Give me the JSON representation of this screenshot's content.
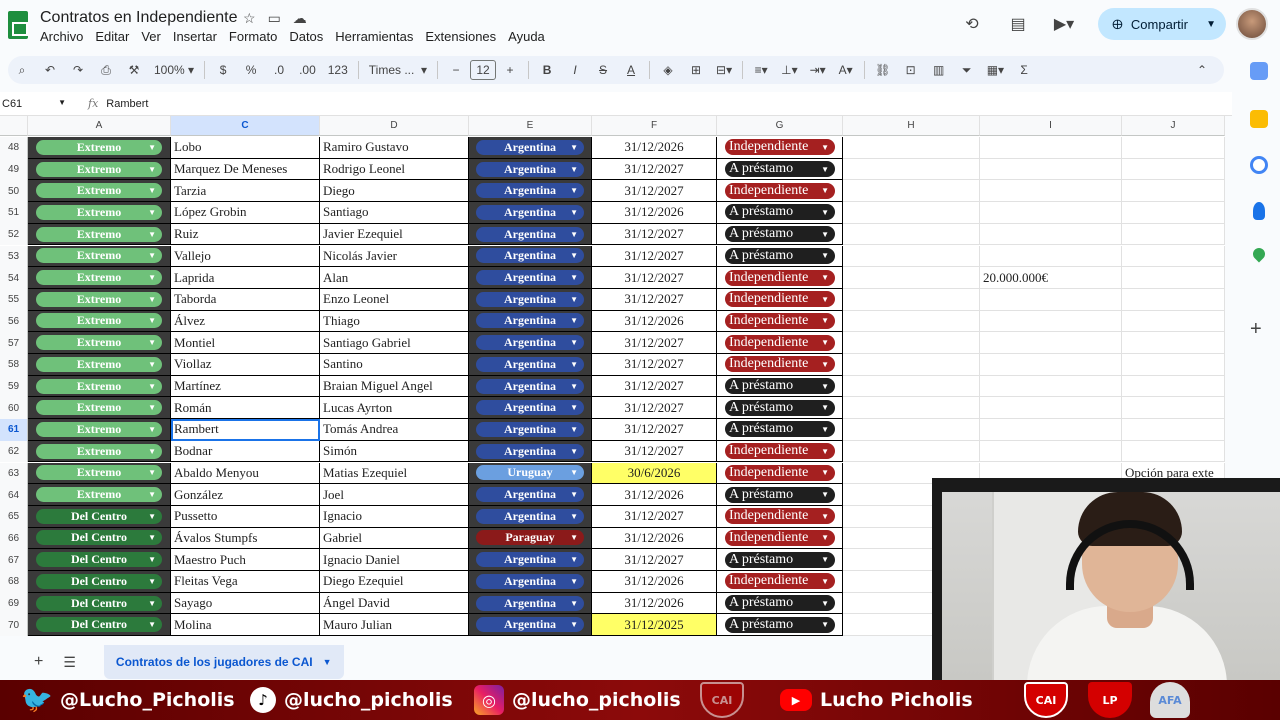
{
  "app": {
    "title": "Contratos en Independiente",
    "menu": [
      "Archivo",
      "Editar",
      "Ver",
      "Insertar",
      "Formato",
      "Datos",
      "Herramientas",
      "Extensiones",
      "Ayuda"
    ],
    "share_label": "Compartir"
  },
  "toolbar": {
    "zoom": "100%",
    "currency": "$",
    "percent": "%",
    "dec_less": ".0",
    "dec_more": ".00",
    "number_format": "123",
    "font": "Times ...",
    "font_size": "12"
  },
  "formula": {
    "cell_ref": "C61",
    "fx": "fx",
    "value": "Rambert"
  },
  "columns": [
    "A",
    "C",
    "D",
    "E",
    "F",
    "G",
    "H",
    "I",
    "J"
  ],
  "rows": [
    {
      "n": "48",
      "pos": "Extremo",
      "apellido": "Lobo",
      "nombre": "Ramiro Gustavo",
      "pais": "Argentina",
      "fecha": "31/12/2026",
      "estado": "Independiente",
      "extra": "",
      "note": ""
    },
    {
      "n": "49",
      "pos": "Extremo",
      "apellido": "Marquez De Meneses",
      "nombre": "Rodrigo Leonel",
      "pais": "Argentina",
      "fecha": "31/12/2027",
      "estado": "A préstamo",
      "extra": "",
      "note": ""
    },
    {
      "n": "50",
      "pos": "Extremo",
      "apellido": "Tarzia",
      "nombre": "Diego",
      "pais": "Argentina",
      "fecha": "31/12/2027",
      "estado": "Independiente",
      "extra": "",
      "note": ""
    },
    {
      "n": "51",
      "pos": "Extremo",
      "apellido": "López Grobin",
      "nombre": "Santiago",
      "pais": "Argentina",
      "fecha": "31/12/2026",
      "estado": "A préstamo",
      "extra": "",
      "note": ""
    },
    {
      "n": "52",
      "pos": "Extremo",
      "apellido": "Ruiz",
      "nombre": "Javier Ezequiel",
      "pais": "Argentina",
      "fecha": "31/12/2027",
      "estado": "A préstamo",
      "extra": "",
      "note": ""
    },
    {
      "n": "53",
      "pos": "Extremo",
      "apellido": "Vallejo",
      "nombre": "Nicolás Javier",
      "pais": "Argentina",
      "fecha": "31/12/2027",
      "estado": "A préstamo",
      "extra": "",
      "note": ""
    },
    {
      "n": "54",
      "pos": "Extremo",
      "apellido": "Laprida",
      "nombre": "Alan",
      "pais": "Argentina",
      "fecha": "31/12/2027",
      "estado": "Independiente",
      "extra": "20.000.000€",
      "note": ""
    },
    {
      "n": "55",
      "pos": "Extremo",
      "apellido": "Taborda",
      "nombre": "Enzo Leonel",
      "pais": "Argentina",
      "fecha": "31/12/2027",
      "estado": "Independiente",
      "extra": "",
      "note": ""
    },
    {
      "n": "56",
      "pos": "Extremo",
      "apellido": "Álvez",
      "nombre": "Thiago",
      "pais": "Argentina",
      "fecha": "31/12/2026",
      "estado": "Independiente",
      "extra": "",
      "note": ""
    },
    {
      "n": "57",
      "pos": "Extremo",
      "apellido": "Montiel",
      "nombre": "Santiago Gabriel",
      "pais": "Argentina",
      "fecha": "31/12/2027",
      "estado": "Independiente",
      "extra": "",
      "note": ""
    },
    {
      "n": "58",
      "pos": "Extremo",
      "apellido": "Viollaz",
      "nombre": "Santino",
      "pais": "Argentina",
      "fecha": "31/12/2027",
      "estado": "Independiente",
      "extra": "",
      "note": ""
    },
    {
      "n": "59",
      "pos": "Extremo",
      "apellido": "Martínez",
      "nombre": "Braian Miguel Angel",
      "pais": "Argentina",
      "fecha": "31/12/2027",
      "estado": "A préstamo",
      "extra": "",
      "note": ""
    },
    {
      "n": "60",
      "pos": "Extremo",
      "apellido": "Román",
      "nombre": "Lucas Ayrton",
      "pais": "Argentina",
      "fecha": "31/12/2027",
      "estado": "A préstamo",
      "extra": "",
      "note": ""
    },
    {
      "n": "61",
      "pos": "Extremo",
      "apellido": "Rambert",
      "nombre": "Tomás Andrea",
      "pais": "Argentina",
      "fecha": "31/12/2027",
      "estado": "A préstamo",
      "extra": "",
      "note": ""
    },
    {
      "n": "62",
      "pos": "Extremo",
      "apellido": "Bodnar",
      "nombre": "Simón",
      "pais": "Argentina",
      "fecha": "31/12/2027",
      "estado": "Independiente",
      "extra": "",
      "note": ""
    },
    {
      "n": "63",
      "pos": "Extremo",
      "apellido": "Abaldo Menyou",
      "nombre": "Matias Ezequiel",
      "pais": "Uruguay",
      "fecha": "30/6/2026",
      "estado": "Independiente",
      "extra": "",
      "note": "Opción para exte"
    },
    {
      "n": "64",
      "pos": "Extremo",
      "apellido": "González",
      "nombre": "Joel",
      "pais": "Argentina",
      "fecha": "31/12/2026",
      "estado": "A préstamo",
      "extra": "",
      "note": ""
    },
    {
      "n": "65",
      "pos": "Del Centro",
      "apellido": "Pussetto",
      "nombre": "Ignacio",
      "pais": "Argentina",
      "fecha": "31/12/2027",
      "estado": "Independiente",
      "extra": "",
      "note": ""
    },
    {
      "n": "66",
      "pos": "Del Centro",
      "apellido": "Ávalos Stumpfs",
      "nombre": "Gabriel",
      "pais": "Paraguay",
      "fecha": "31/12/2026",
      "estado": "Independiente",
      "extra": "",
      "note": ""
    },
    {
      "n": "67",
      "pos": "Del Centro",
      "apellido": "Maestro Puch",
      "nombre": "Ignacio Daniel",
      "pais": "Argentina",
      "fecha": "31/12/2027",
      "estado": "A préstamo",
      "extra": "",
      "note": ""
    },
    {
      "n": "68",
      "pos": "Del Centro",
      "apellido": "Fleitas Vega",
      "nombre": "Diego Ezequiel",
      "pais": "Argentina",
      "fecha": "31/12/2026",
      "estado": "Independiente",
      "extra": "",
      "note": ""
    },
    {
      "n": "69",
      "pos": "Del Centro",
      "apellido": "Sayago",
      "nombre": "Ángel David",
      "pais": "Argentina",
      "fecha": "31/12/2026",
      "estado": "A préstamo",
      "extra": "",
      "note": ""
    },
    {
      "n": "70",
      "pos": "Del Centro",
      "apellido": "Molina",
      "nombre": "Mauro Julian",
      "pais": "Argentina",
      "fecha": "31/12/2025",
      "estado": "A préstamo",
      "extra": "",
      "note": ""
    }
  ],
  "sheet_tab": "Contratos de los jugadores de CAI",
  "social": {
    "twitter": "@Lucho_Picholis",
    "tiktok": "@lucho_picholis",
    "instagram": "@lucho_picholis",
    "youtube": "Lucho Picholis",
    "crest_cai": "CAI",
    "crest_lp": "LP",
    "crest_afa": "AFA"
  },
  "colors": {
    "extremo": "#6fc17a",
    "del_centro": "#2c7a3c",
    "argentina": "#2f4d9e",
    "uruguay": "#6b9fe0",
    "paraguay": "#8b1a1a",
    "independiente": "#a52020",
    "prestamo": "#1f1f1f",
    "highlight_date": "#ffff66",
    "share": "#c2e7ff"
  },
  "icons": [
    "sheets-logo-icon",
    "star-icon",
    "folder-move-icon",
    "cloud-icon",
    "history-icon",
    "comment-icon",
    "video-call-icon",
    "globe-icon",
    "search-icon",
    "undo-icon",
    "redo-icon",
    "print-icon",
    "paint-format-icon"
  ]
}
